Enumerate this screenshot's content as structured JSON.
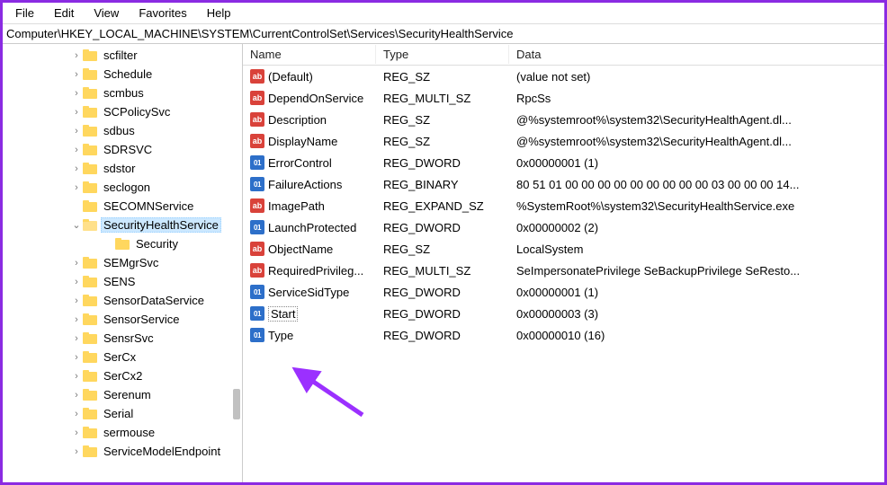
{
  "menu": {
    "file": "File",
    "edit": "Edit",
    "view": "View",
    "favorites": "Favorites",
    "help": "Help"
  },
  "address": "Computer\\HKEY_LOCAL_MACHINE\\SYSTEM\\CurrentControlSet\\Services\\SecurityHealthService",
  "tree": {
    "items": [
      {
        "label": "scfilter",
        "exp": ">",
        "indent": 75
      },
      {
        "label": "Schedule",
        "exp": ">",
        "indent": 75
      },
      {
        "label": "scmbus",
        "exp": ">",
        "indent": 75
      },
      {
        "label": "SCPolicySvc",
        "exp": ">",
        "indent": 75
      },
      {
        "label": "sdbus",
        "exp": ">",
        "indent": 75
      },
      {
        "label": "SDRSVC",
        "exp": ">",
        "indent": 75
      },
      {
        "label": "sdstor",
        "exp": ">",
        "indent": 75
      },
      {
        "label": "seclogon",
        "exp": ">",
        "indent": 75
      },
      {
        "label": "SECOMNService",
        "exp": "",
        "indent": 75
      },
      {
        "label": "SecurityHealthService",
        "exp": "v",
        "indent": 75,
        "selected": true,
        "open": true
      },
      {
        "label": "Security",
        "exp": "",
        "indent": 111
      },
      {
        "label": "SEMgrSvc",
        "exp": ">",
        "indent": 75
      },
      {
        "label": "SENS",
        "exp": ">",
        "indent": 75
      },
      {
        "label": "SensorDataService",
        "exp": ">",
        "indent": 75
      },
      {
        "label": "SensorService",
        "exp": ">",
        "indent": 75
      },
      {
        "label": "SensrSvc",
        "exp": ">",
        "indent": 75
      },
      {
        "label": "SerCx",
        "exp": ">",
        "indent": 75
      },
      {
        "label": "SerCx2",
        "exp": ">",
        "indent": 75
      },
      {
        "label": "Serenum",
        "exp": ">",
        "indent": 75
      },
      {
        "label": "Serial",
        "exp": ">",
        "indent": 75
      },
      {
        "label": "sermouse",
        "exp": ">",
        "indent": 75
      },
      {
        "label": "ServiceModelEndpoint",
        "exp": ">",
        "indent": 75
      }
    ]
  },
  "columns": {
    "name": "Name",
    "type": "Type",
    "data": "Data"
  },
  "values": [
    {
      "name": "(Default)",
      "kind": "str",
      "type": "REG_SZ",
      "data": "(value not set)"
    },
    {
      "name": "DependOnService",
      "kind": "str",
      "type": "REG_MULTI_SZ",
      "data": "RpcSs"
    },
    {
      "name": "Description",
      "kind": "str",
      "type": "REG_SZ",
      "data": "@%systemroot%\\system32\\SecurityHealthAgent.dl..."
    },
    {
      "name": "DisplayName",
      "kind": "str",
      "type": "REG_SZ",
      "data": "@%systemroot%\\system32\\SecurityHealthAgent.dl..."
    },
    {
      "name": "ErrorControl",
      "kind": "bin",
      "type": "REG_DWORD",
      "data": "0x00000001 (1)"
    },
    {
      "name": "FailureActions",
      "kind": "bin",
      "type": "REG_BINARY",
      "data": "80 51 01 00 00 00 00 00 00 00 00 00 03 00 00 00 14..."
    },
    {
      "name": "ImagePath",
      "kind": "str",
      "type": "REG_EXPAND_SZ",
      "data": "%SystemRoot%\\system32\\SecurityHealthService.exe"
    },
    {
      "name": "LaunchProtected",
      "kind": "bin",
      "type": "REG_DWORD",
      "data": "0x00000002 (2)"
    },
    {
      "name": "ObjectName",
      "kind": "str",
      "type": "REG_SZ",
      "data": "LocalSystem"
    },
    {
      "name": "RequiredPrivileg...",
      "kind": "str",
      "type": "REG_MULTI_SZ",
      "data": "SeImpersonatePrivilege SeBackupPrivilege SeResto..."
    },
    {
      "name": "ServiceSidType",
      "kind": "bin",
      "type": "REG_DWORD",
      "data": "0x00000001 (1)"
    },
    {
      "name": "Start",
      "kind": "bin",
      "type": "REG_DWORD",
      "data": "0x00000003 (3)",
      "focus": true
    },
    {
      "name": "Type",
      "kind": "bin",
      "type": "REG_DWORD",
      "data": "0x00000010 (16)"
    }
  ]
}
